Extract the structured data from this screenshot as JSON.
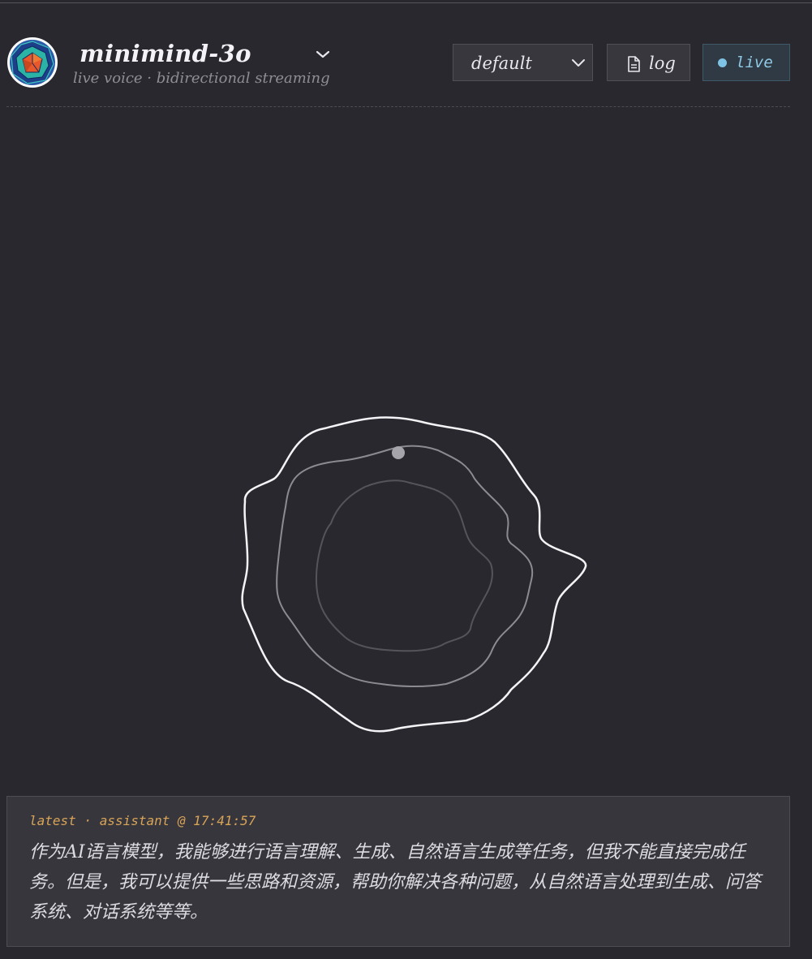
{
  "header": {
    "title": "minimind-3o",
    "subtitle": "live voice · bidirectional streaming",
    "logo_icon": "polyhedron-logo-icon",
    "model_menu_icon": "chevron-down-icon"
  },
  "controls": {
    "voice_select": {
      "value": "default",
      "icon": "chevron-down-icon"
    },
    "log_button": {
      "label": "log",
      "icon": "document-icon"
    },
    "live_button": {
      "label": "live",
      "status_color": "#7fc3e4"
    }
  },
  "latest_message": {
    "meta": "latest · assistant @ 17:41:57",
    "text": "作为AI语言模型，我能够进行语言理解、生成、自然语言生成等任务，但我不能直接完成任务。但是，我可以提供一些思路和资源，帮助你解决各种问题，从自然语言处理到生成、问答系统、对话系统等等。"
  },
  "colors": {
    "background": "#29282e",
    "panel": "#37363d",
    "accent_live": "#7fc3e4",
    "meta_text": "#d8a457"
  }
}
